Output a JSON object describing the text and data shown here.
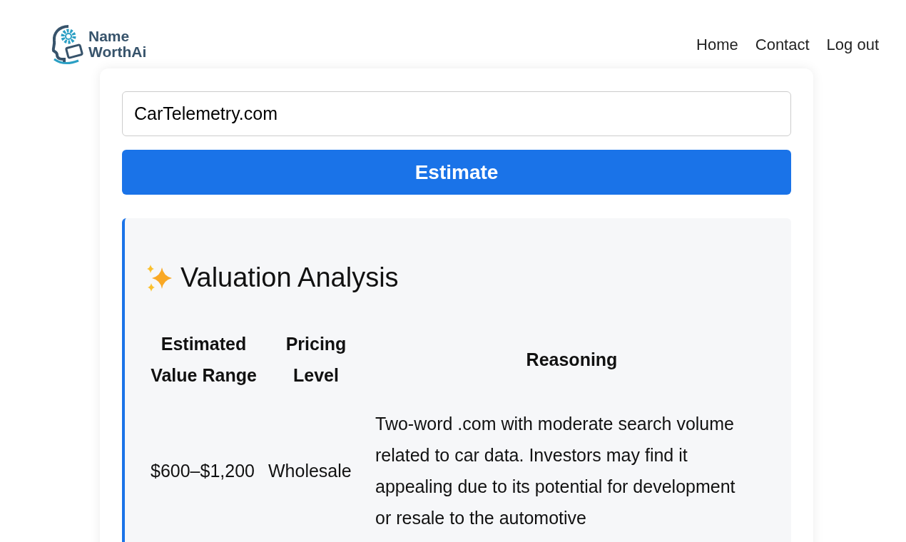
{
  "logo": {
    "line_1": "Name",
    "line_2": "WorthAi"
  },
  "nav": [
    "Home",
    "Contact",
    "Log out"
  ],
  "domain_field": {
    "value": "CarTelemetry.com"
  },
  "estimate_button": "Estimate",
  "result": {
    "title": "Valuation Analysis",
    "table": {
      "columns": [
        "Estimated Value Range",
        "Pricing Level",
        "Reasoning"
      ],
      "rows": [
        {
          "cells": [
            "$600–$1,200",
            "Wholesale",
            "Two-word .com with moderate search volume related to car data. Investors may find it appealing due to its potential for development or resale to the automotive"
          ]
        }
      ]
    }
  }
}
